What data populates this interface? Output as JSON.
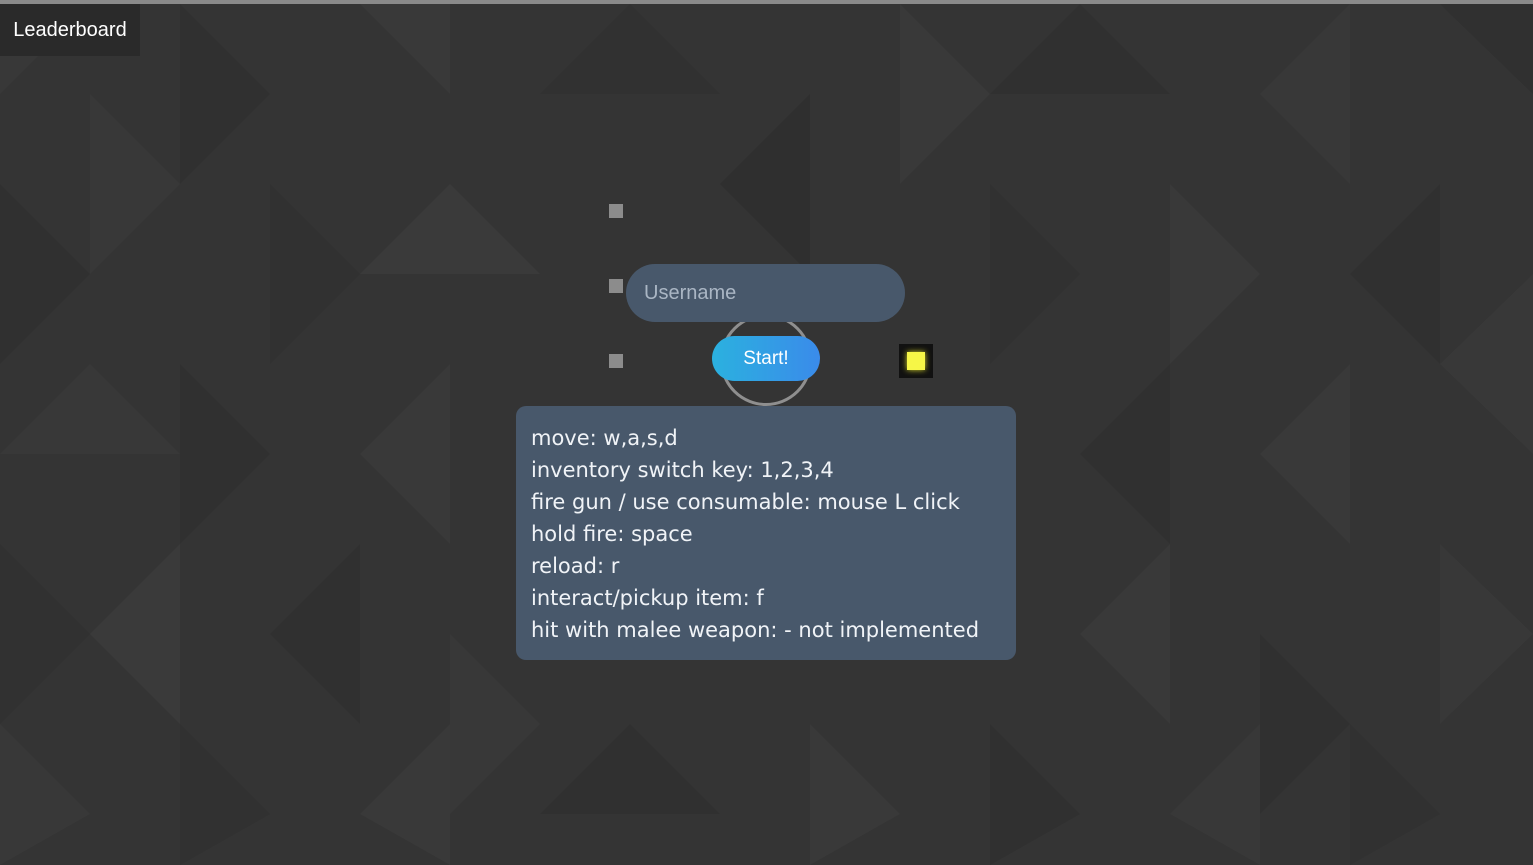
{
  "header": {
    "leaderboard_label": "Leaderboard"
  },
  "login": {
    "username_placeholder": "Username",
    "start_label": "Start!"
  },
  "instructions": [
    "move: w,a,s,d",
    "inventory switch key: 1,2,3,4",
    "fire gun / use consumable: mouse L click",
    "hold fire: space",
    "reload: r",
    "interact/pickup item: f",
    "hit with malee weapon: - not implemented"
  ],
  "colors": {
    "background": "#343434",
    "panel": "#48586b",
    "start_gradient_from": "#2bb1df",
    "start_gradient_to": "#3a8bea",
    "item_fill": "#f6f647",
    "small_square": "#8c8c8c"
  },
  "icons": {
    "item_marker": "yellow-square-icon",
    "player_marker": "player-ring-icon"
  }
}
